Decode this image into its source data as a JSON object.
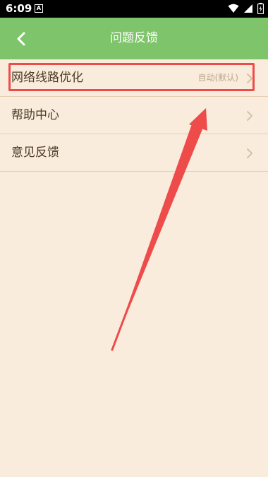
{
  "status_bar": {
    "time": "6:09",
    "notification_glyph": "A",
    "icons": [
      "wifi-icon",
      "signal-icon",
      "battery-charging-icon"
    ]
  },
  "navbar": {
    "title": "问题反馈",
    "back_icon": "chevron-left-icon"
  },
  "list": {
    "items": [
      {
        "label": "网络线路优化",
        "value": "自动(默认)"
      },
      {
        "label": "帮助中心",
        "value": ""
      },
      {
        "label": "意见反馈",
        "value": ""
      }
    ]
  },
  "colors": {
    "navbar": "#7ec46a",
    "background": "#faecdc",
    "annotation": "#ee4b4b",
    "divider": "#e6cdb3"
  }
}
